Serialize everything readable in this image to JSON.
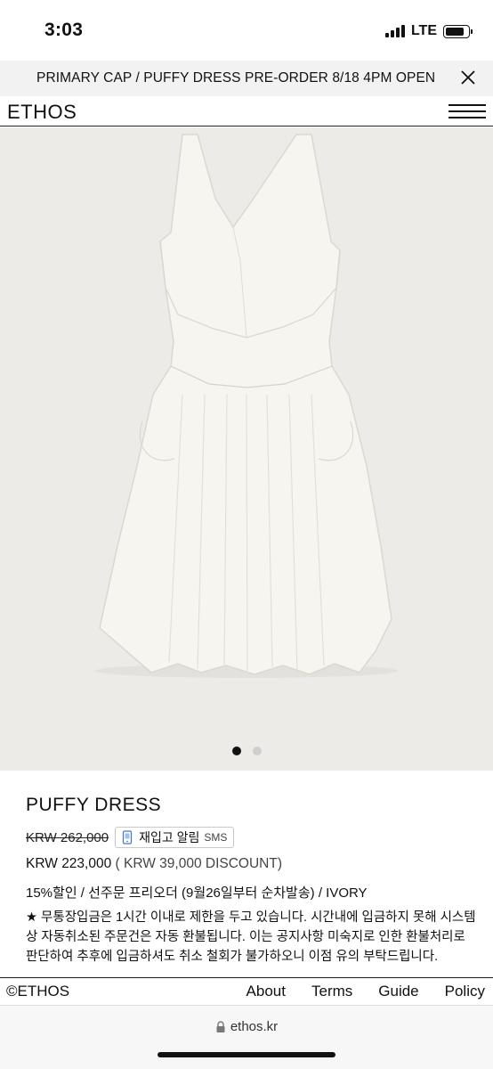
{
  "status_bar": {
    "time": "3:03",
    "network": "LTE",
    "battery_level": 0.85
  },
  "announcement": {
    "text": "PRIMARY CAP / PUFFY DRESS PRE-ORDER 8/18 4PM OPEN",
    "close_icon": "close-icon"
  },
  "header": {
    "logo": "ETHOS",
    "menu_icon": "hamburger-menu-icon"
  },
  "gallery": {
    "image": "ivory sleeveless pleated dress photo",
    "slide_count": 2,
    "active_slide": 1
  },
  "product": {
    "name": "PUFFY DRESS",
    "original_price": "KRW 262,000",
    "restock_label": "재입고 알림",
    "restock_sms": "SMS",
    "price": "KRW 223,000",
    "discount": "( KRW 39,000 DISCOUNT)",
    "discount_note": "15%할인 / 선주문 프리오더 (9월26일부터 순차발송) / IVORY",
    "notice": "★ 무통장입금은 1시간 이내로 제한을 두고 있습니다. 시간내에 입금하지 못해 시스템상 자동취소된 주문건은 자동 환불됩니다. 이는 공지사항 미숙지로 인한 환불처리로 판단하여 추후에 입금하셔도 취소 철회가 불가하오니 이점 유의 부탁드립니다."
  },
  "footer": {
    "copyright": "©ETHOS",
    "links": [
      "About",
      "Terms",
      "Guide",
      "Policy"
    ]
  },
  "browser": {
    "url": "ethos.kr"
  },
  "colors": {
    "background": "#ffffff",
    "announcement_bg": "#f2f2f2",
    "gallery_bg": "#ececea",
    "text": "#111111",
    "dress": "#f6f4ee"
  }
}
